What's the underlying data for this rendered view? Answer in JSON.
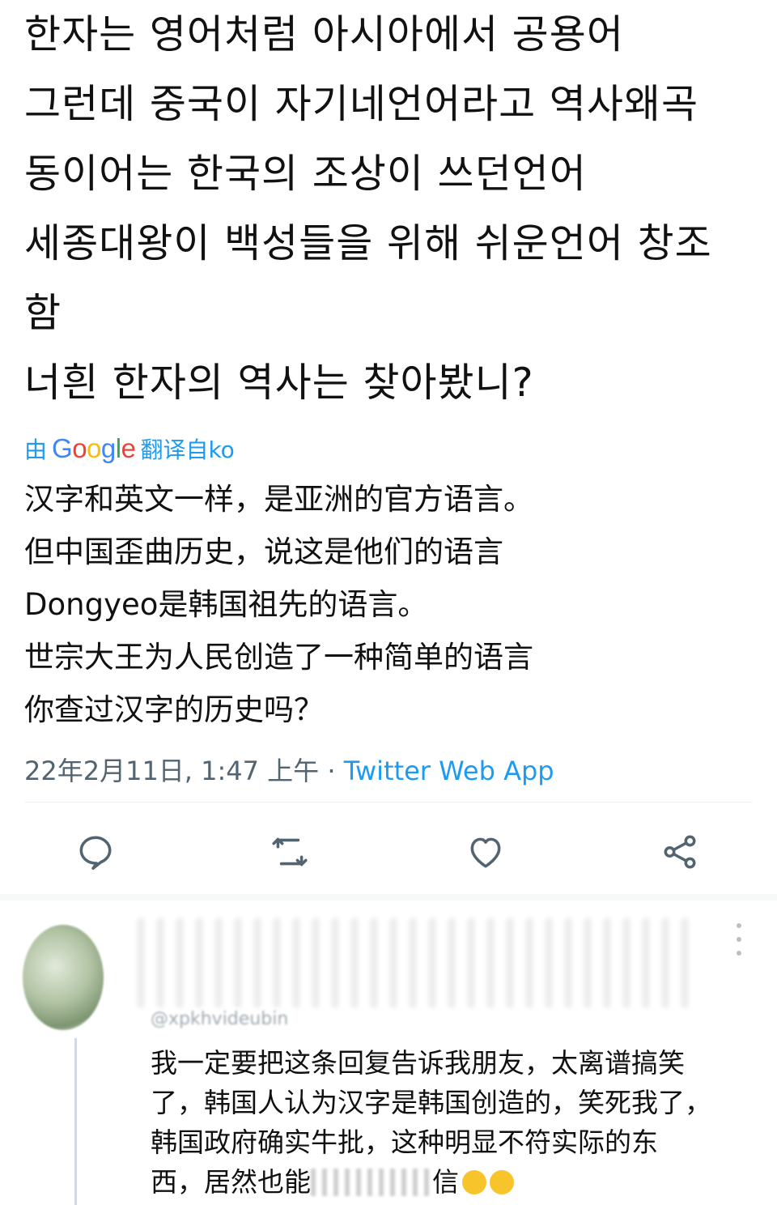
{
  "tweet": {
    "original_lines": [
      "한자는 영어처럼 아시아에서 공용어",
      "그런데 중국이 자기네언어라고 역사왜곡",
      "동이어는 한국의 조상이 쓰던언어",
      "세종대왕이 백성들을 위해 쉬운언어 창조",
      "함",
      "너흰 한자의 역사는 찾아봤니?"
    ],
    "translated_by_prefix": "由",
    "translated_by_brand": "Google",
    "translated_by_suffix": "翻译自ko",
    "translation_lines": [
      "汉字和英文一样，是亚洲的官方语言。",
      "但中国歪曲历史，说这是他们的语言",
      "Dongyeo是韩国祖先的语言。",
      "世宗大王为人民创造了一种简单的语言",
      "你查过汉字的历史吗？"
    ],
    "timestamp": "22年2月11日, 1:47 上午",
    "separator": " · ",
    "source": "Twitter Web App"
  },
  "actions": {
    "reply_icon": "reply-icon",
    "retweet_icon": "retweet-icon",
    "like_icon": "heart-icon",
    "share_icon": "share-icon"
  },
  "reply": {
    "handle": "@xpkhvideubin",
    "lines": [
      "我一定要把这条回复告诉我朋友，太离谱搞笑",
      "了，韩国人认为汉字是韩国创造的，笑死我了，",
      "韩国政府确实牛批，这种明显不符实际的东",
      "西，居然也能"
    ],
    "last_line_tail": "信"
  },
  "colors": {
    "link": "#1d9bf0",
    "muted": "#536471",
    "icon": "#536471"
  }
}
